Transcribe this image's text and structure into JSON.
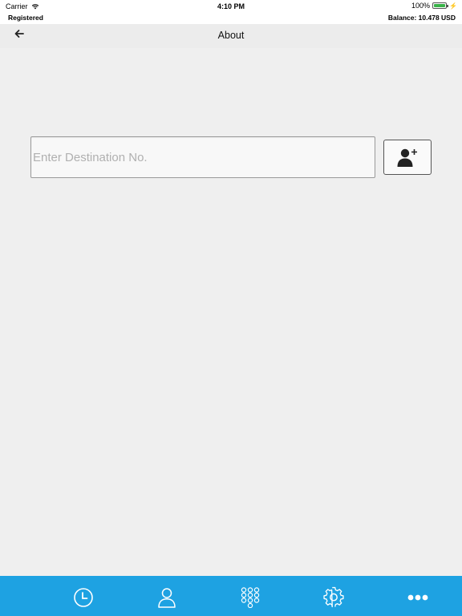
{
  "status_bar": {
    "carrier": "Carrier",
    "time": "4:10 PM",
    "battery_percent": "100%",
    "battery_level": 1.0,
    "battery_color": "#3ab34a"
  },
  "account_bar": {
    "status": "Registered",
    "balance": "Balance: 10.478 USD"
  },
  "nav": {
    "title": "About",
    "back_icon": "arrow-left-icon"
  },
  "destination": {
    "placeholder": "Enter Destination No.",
    "value": ""
  },
  "add_contact_icon": "person-add-icon",
  "tab_bar": {
    "color": "#1ea2e2",
    "tabs": [
      {
        "icon": "clock-icon"
      },
      {
        "icon": "person-icon"
      },
      {
        "icon": "dialpad-icon"
      },
      {
        "icon": "gear-icon"
      },
      {
        "icon": "more-icon"
      }
    ]
  }
}
